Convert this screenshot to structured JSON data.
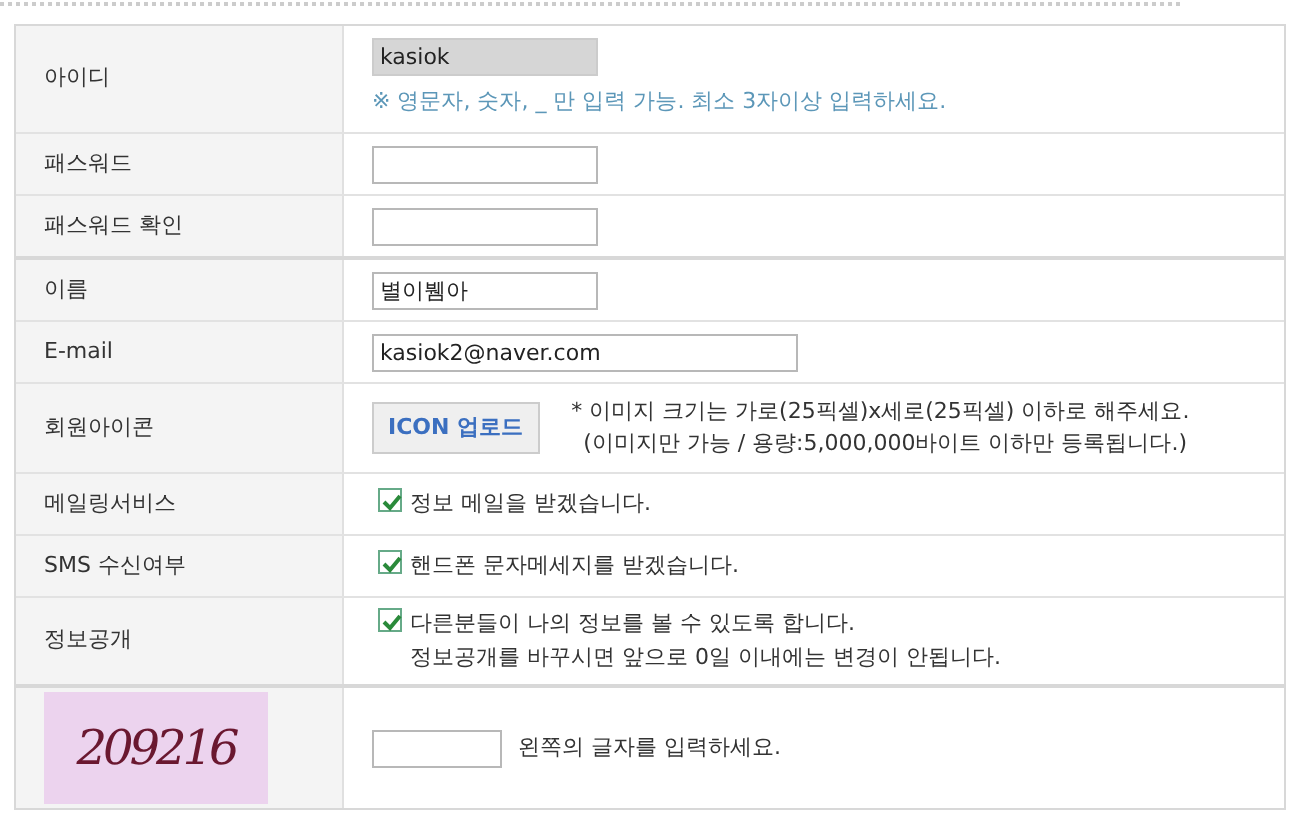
{
  "sections": [
    {
      "rows": [
        {
          "kind": "input",
          "label": "아이디",
          "field": {
            "value": "kasiok",
            "readonly": true,
            "wide": false
          },
          "hint": "※ 영문자, 숫자, _ 만 입력 가능. 최소 3자이상 입력하세요."
        },
        {
          "kind": "password",
          "label": "패스워드",
          "field": {
            "readonly": false,
            "wide": false
          }
        },
        {
          "kind": "password",
          "label": "패스워드 확인",
          "field": {
            "readonly": false,
            "wide": false
          }
        }
      ]
    },
    {
      "rows": [
        {
          "kind": "input",
          "label": "이름",
          "field": {
            "value": "별이뷈아",
            "readonly": false,
            "wide": false
          }
        },
        {
          "kind": "input",
          "label": "E-mail",
          "field": {
            "value": "kasiok2@naver.com",
            "readonly": false,
            "wide": true
          }
        },
        {
          "kind": "upload",
          "label": "회원아이콘",
          "button": "ICON 업로드",
          "notes": [
            "* 이미지 크기는 가로(25픽셀)x세로(25픽셀) 이하로 해주세요.",
            "(이미지만 가능 / 용량:5,000,000바이트 이하만 등록됩니다.)"
          ]
        },
        {
          "kind": "checkbox",
          "label": "메일링서비스",
          "checked": true,
          "lines": [
            "정보 메일을 받겠습니다."
          ]
        },
        {
          "kind": "checkbox",
          "label": "SMS 수신여부",
          "checked": true,
          "lines": [
            "핸드폰 문자메세지를 받겠습니다."
          ]
        },
        {
          "kind": "checkbox",
          "label": "정보공개",
          "checked": true,
          "lines": [
            "다른분들이 나의 정보를 볼 수 있도록 합니다.",
            "정보공개를 바꾸시면 앞으로 0일 이내에는 변경이 안됩니다."
          ]
        }
      ]
    },
    {
      "rows": [
        {
          "kind": "captcha",
          "code": "209216",
          "field": {
            "readonly": false
          },
          "prompt": "왼쪽의 글자를 입력하세요."
        }
      ]
    }
  ]
}
